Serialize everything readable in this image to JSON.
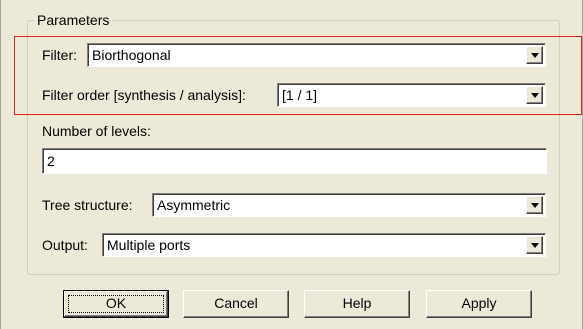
{
  "group": {
    "title": "Parameters"
  },
  "filter": {
    "label": "Filter:",
    "value": "Biorthogonal"
  },
  "filter_order": {
    "label": "Filter order [synthesis / analysis]:",
    "value": "[1 / 1]"
  },
  "levels": {
    "label": "Number of levels:",
    "value": "2"
  },
  "tree": {
    "label": "Tree structure:",
    "value": "Asymmetric"
  },
  "output": {
    "label": "Output:",
    "value": "Multiple ports"
  },
  "buttons": {
    "ok": "OK",
    "cancel": "Cancel",
    "help": "Help",
    "apply": "Apply"
  },
  "colors": {
    "dialog_bg": "#ece9d8",
    "highlight": "#e0241b"
  },
  "icons": {
    "dropdown": "chevron-down-icon"
  }
}
